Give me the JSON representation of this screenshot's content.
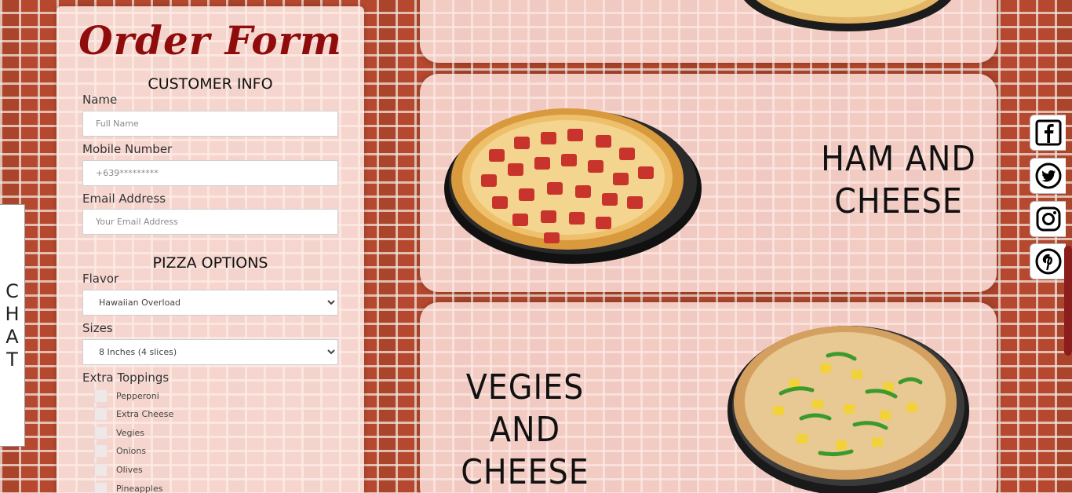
{
  "form": {
    "title": "Order Form",
    "customer_heading": "CUSTOMER INFO",
    "name_label": "Name",
    "name_placeholder": "Full Name",
    "mobile_label": "Mobile Number",
    "mobile_placeholder": "+639*********",
    "email_label": "Email Address",
    "email_placeholder": "Your Email Address",
    "pizza_heading": "PIZZA OPTIONS",
    "flavor_label": "Flavor",
    "flavor_selected": "Hawaiian Overload",
    "sizes_label": "Sizes",
    "size_selected": "8 Inches (4 slices)",
    "toppings_label": "Extra Toppings",
    "toppings": [
      "Pepperoni",
      "Extra Cheese",
      "Vegies",
      "Onions",
      "Olives",
      "Pineapples"
    ]
  },
  "cards": [
    {
      "name": ""
    },
    {
      "name": "HAM AND CHEESE"
    },
    {
      "name": "VEGIES AND CHEESE"
    }
  ],
  "chat": {
    "label": "CHAT"
  },
  "social": [
    "facebook-icon",
    "twitter-icon",
    "instagram-icon",
    "pinterest-icon"
  ],
  "colors": {
    "accent": "#8f0c0c",
    "scroll_thumb": "#8b1d1d"
  }
}
